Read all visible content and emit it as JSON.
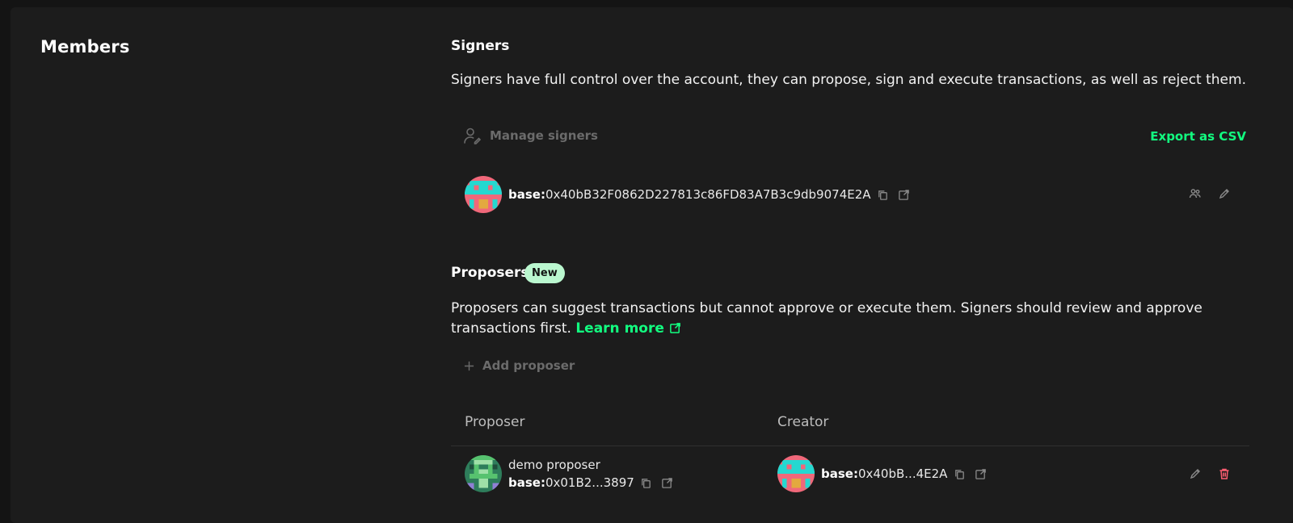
{
  "members": {
    "title": "Members"
  },
  "signers": {
    "title": "Signers",
    "description": "Signers have full control over the account, they can propose, sign and execute transactions, as well as reject them.",
    "manage_label": "Manage signers",
    "export_label": "Export as CSV",
    "items": [
      {
        "chain": "base:",
        "address": "0x40bB32F0862D227813c86FD83A7B3c9db9074E2A"
      }
    ]
  },
  "proposers": {
    "title": "Proposers",
    "badge": "New",
    "description": "Proposers can suggest transactions but cannot approve or execute them. Signers should review and approve transactions first.",
    "learn_more": "Learn more",
    "add_label": "Add proposer",
    "columns": {
      "proposer": "Proposer",
      "creator": "Creator"
    },
    "items": [
      {
        "name": "demo proposer",
        "chain": "base:",
        "address": "0x01B2...3897",
        "creator_chain": "base:",
        "creator_address": "0x40bB...4E2A"
      }
    ]
  },
  "colors": {
    "accent_green": "#12ff80",
    "badge_bg": "#baf7cf",
    "danger_red": "#ff5f72",
    "muted": "#6b6b6b"
  },
  "icons": [
    "user-edit-icon",
    "copy-icon",
    "external-link-icon",
    "signers-icon",
    "edit-icon",
    "plus-icon",
    "trash-icon"
  ]
}
